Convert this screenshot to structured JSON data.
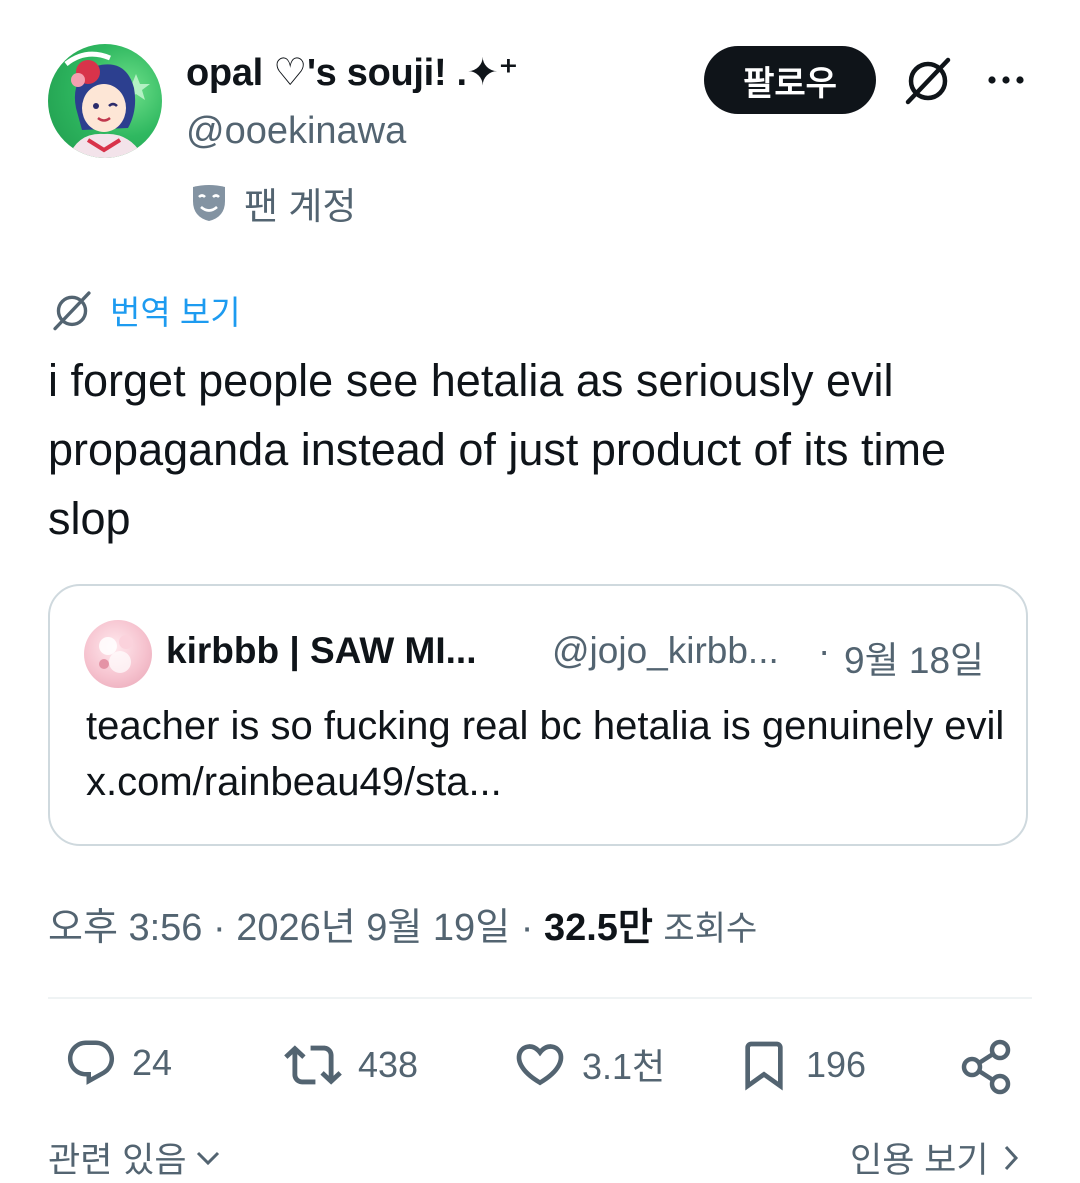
{
  "author": {
    "display_name": "opal ♡'s souji! .✦⁺",
    "handle": "@ooekinawa",
    "fan_label": "팬 계정"
  },
  "header": {
    "follow_label": "팔로우"
  },
  "translate_label": "번역 보기",
  "tweet": {
    "text": "i forget people see hetalia as seriously evil propaganda instead of just product of its time slop"
  },
  "quote": {
    "name": "kirbbb | SAW MI...",
    "handle": "@jojo_kirbb...",
    "separator": "·",
    "date": "9월 18일",
    "text": "teacher is so fucking real bc hetalia is genuinely evil x.com/rainbeau49/sta..."
  },
  "meta": {
    "time": "오후 3:56",
    "sep1": " · ",
    "date": "2026년 9월 19일",
    "sep2": " · ",
    "views_count": "32.5만",
    "views_label": "조회수"
  },
  "actions": {
    "replies": "24",
    "reposts": "438",
    "likes": "3.1천",
    "bookmarks": "196"
  },
  "footer": {
    "related": "관련 있음",
    "quotes": "인용 보기"
  },
  "colors": {
    "accent": "#1d9bf0",
    "text": "#0f1419",
    "secondary": "#536471",
    "border": "#cfd9de"
  }
}
